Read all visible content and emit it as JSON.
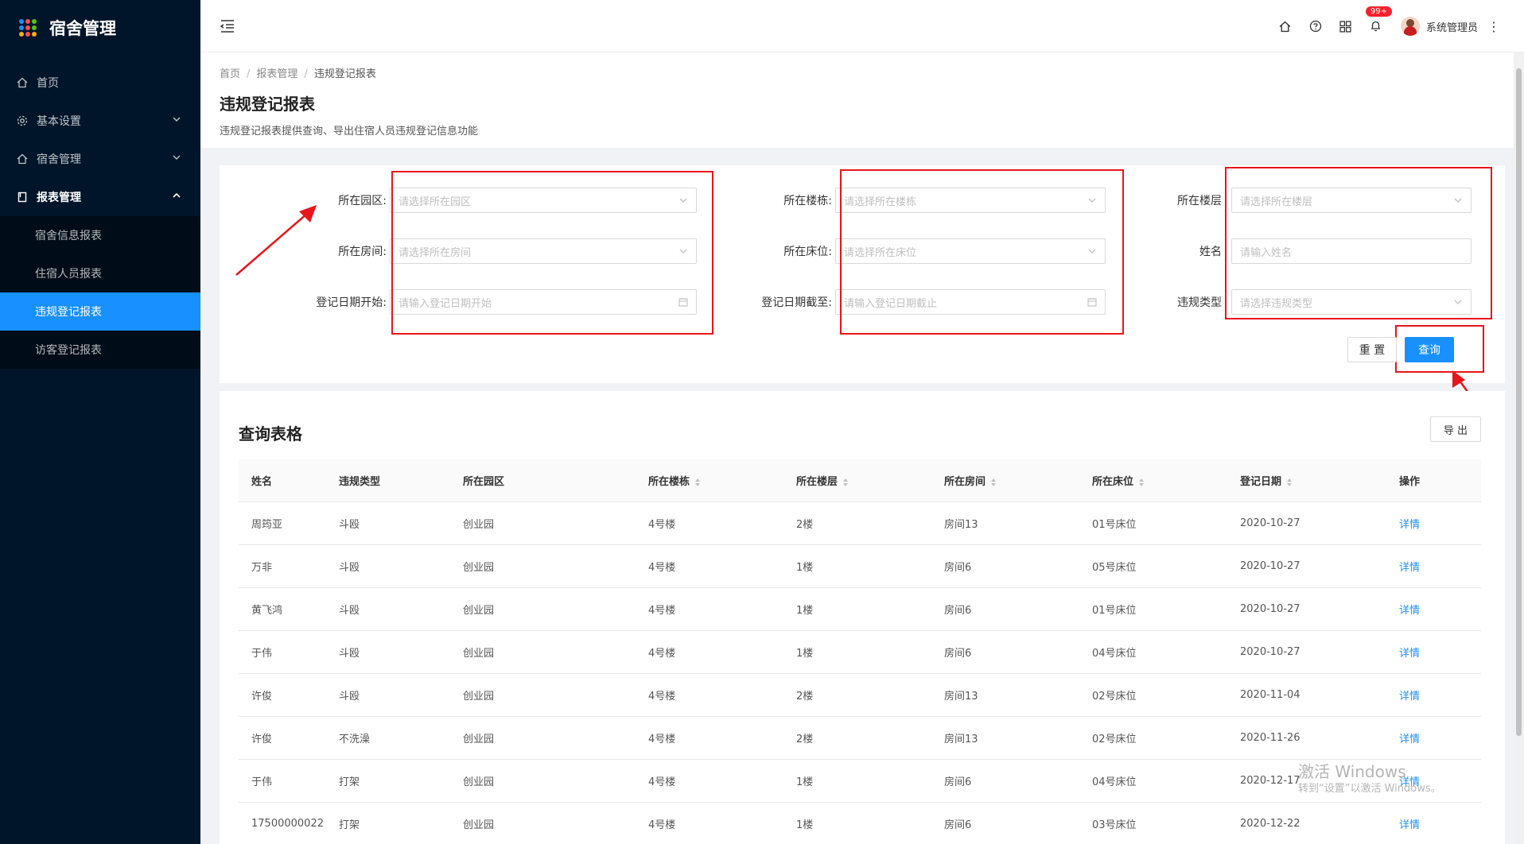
{
  "app": {
    "title": "宿舍管理"
  },
  "sidebar": {
    "items": [
      {
        "label": "首页"
      },
      {
        "label": "基本设置"
      },
      {
        "label": "宿舍管理"
      },
      {
        "label": "报表管理"
      }
    ],
    "subitems": [
      {
        "label": "宿舍信息报表"
      },
      {
        "label": "住宿人员报表"
      },
      {
        "label": "违规登记报表"
      },
      {
        "label": "访客登记报表"
      }
    ]
  },
  "header": {
    "badge": "99+",
    "user": "系统管理员"
  },
  "page": {
    "breadcrumb": [
      "首页",
      "报表管理",
      "违规登记报表"
    ],
    "title": "违规登记报表",
    "description": "违规登记报表提供查询、导出住宿人员违规登记信息功能"
  },
  "filters": {
    "park_label": "所在园区:",
    "park_placeholder": "请选择所在园区",
    "building_label": "所在楼栋:",
    "building_placeholder": "请选择所在楼栋",
    "floor_label": "所在楼层",
    "floor_placeholder": "请选择所在楼层",
    "room_label": "所在房间:",
    "room_placeholder": "请选择所在房间",
    "bed_label": "所在床位:",
    "bed_placeholder": "请选择所在床位",
    "name_label": "姓名",
    "name_placeholder": "请输入姓名",
    "date_start_label": "登记日期开始:",
    "date_start_placeholder": "请输入登记日期开始",
    "date_end_label": "登记日期截至:",
    "date_end_placeholder": "请输入登记日期截止",
    "type_label": "违规类型",
    "type_placeholder": "请选择违规类型",
    "reset_label": "重 置",
    "query_label": "查询"
  },
  "table": {
    "title": "查询表格",
    "export_label": "导 出",
    "columns": [
      "姓名",
      "违规类型",
      "所在园区",
      "所在楼栋",
      "所在楼层",
      "所在房间",
      "所在床位",
      "登记日期",
      "操作"
    ],
    "rows": [
      [
        "周筠亚",
        "斗殴",
        "创业园",
        "4号楼",
        "2楼",
        "房间13",
        "01号床位",
        "2020-10-27",
        "详情"
      ],
      [
        "万非",
        "斗殴",
        "创业园",
        "4号楼",
        "1楼",
        "房间6",
        "05号床位",
        "2020-10-27",
        "详情"
      ],
      [
        "黄飞鸿",
        "斗殴",
        "创业园",
        "4号楼",
        "1楼",
        "房间6",
        "01号床位",
        "2020-10-27",
        "详情"
      ],
      [
        "于伟",
        "斗殴",
        "创业园",
        "4号楼",
        "1楼",
        "房间6",
        "04号床位",
        "2020-10-27",
        "详情"
      ],
      [
        "许俊",
        "斗殴",
        "创业园",
        "4号楼",
        "2楼",
        "房间13",
        "02号床位",
        "2020-11-04",
        "详情"
      ],
      [
        "许俊",
        "不洗澡",
        "创业园",
        "4号楼",
        "2楼",
        "房间13",
        "02号床位",
        "2020-11-26",
        "详情"
      ],
      [
        "于伟",
        "打架",
        "创业园",
        "4号楼",
        "1楼",
        "房间6",
        "04号床位",
        "2020-12-17",
        "详情"
      ],
      [
        "17500000022",
        "打架",
        "创业园",
        "4号楼",
        "1楼",
        "房间6",
        "03号床位",
        "2020-12-22",
        "详情"
      ]
    ]
  },
  "watermark": {
    "line1": "激活 Windows",
    "line2": "转到“设置”以激活 Windows。"
  }
}
